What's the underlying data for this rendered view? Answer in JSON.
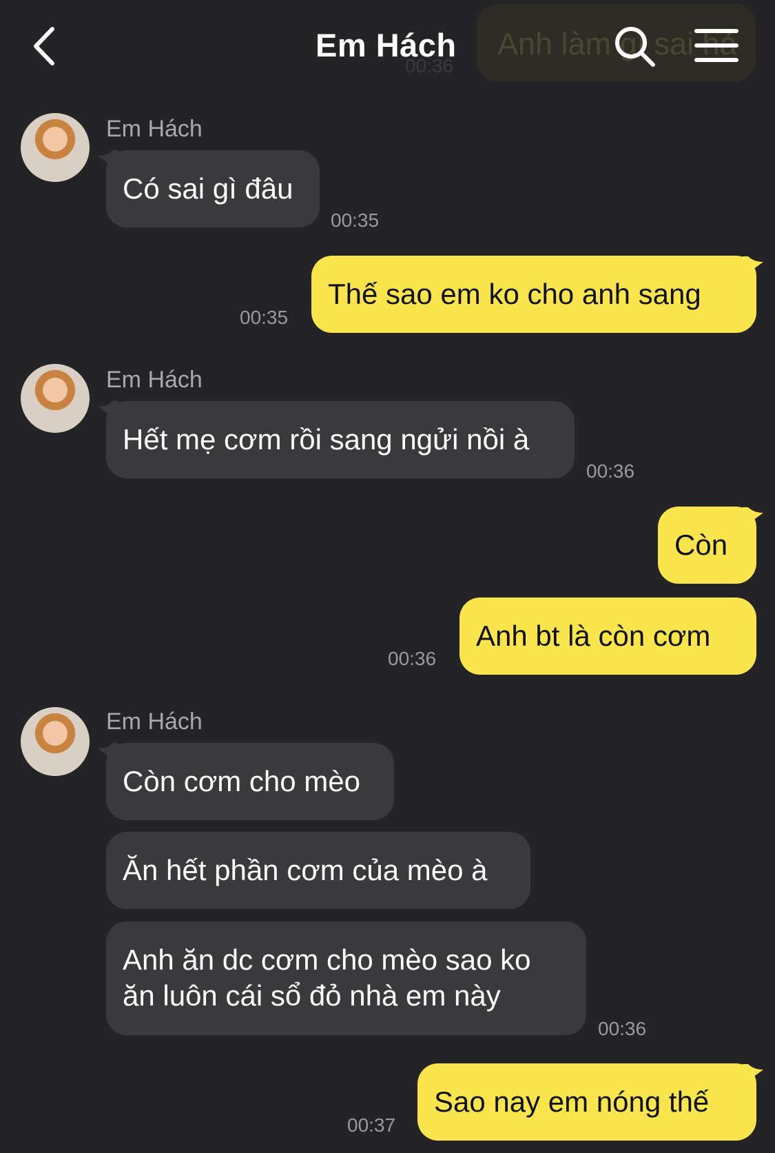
{
  "header": {
    "title": "Em Hách",
    "overlay_text": "Anh làm gì sai hả",
    "overlay_time": "00:36"
  },
  "messages": [
    {
      "side": "in",
      "sender": "Em Hách",
      "text": "Có sai gì đâu",
      "time": "00:35"
    },
    {
      "side": "out",
      "text": "Thế sao em ko cho anh sang",
      "time": "00:35"
    },
    {
      "side": "in",
      "sender": "Em Hách",
      "text": "Hết mẹ cơm rồi sang ngửi nồi à",
      "time": "00:36"
    },
    {
      "side": "out",
      "text": "Còn"
    },
    {
      "side": "out",
      "text": "Anh bt là còn cơm",
      "time": "00:36"
    },
    {
      "side": "in",
      "sender": "Em Hách",
      "text": "Còn cơm cho mèo"
    },
    {
      "side": "in",
      "text": "Ăn hết phần cơm của mèo à"
    },
    {
      "side": "in",
      "text": "Anh ăn dc cơm cho mèo sao ko ăn luôn cái sổ đỏ nhà em này",
      "time": "00:36"
    },
    {
      "side": "out",
      "text": "Sao nay em nóng thế",
      "time": "00:37"
    }
  ],
  "colors": {
    "background": "#242427",
    "incoming_bubble": "#3a3a3d",
    "outgoing_bubble": "#fae64c",
    "timestamp": "#9a9a9e"
  },
  "icons": [
    "back-arrow-icon",
    "search-icon",
    "menu-icon",
    "avatar-image"
  ]
}
